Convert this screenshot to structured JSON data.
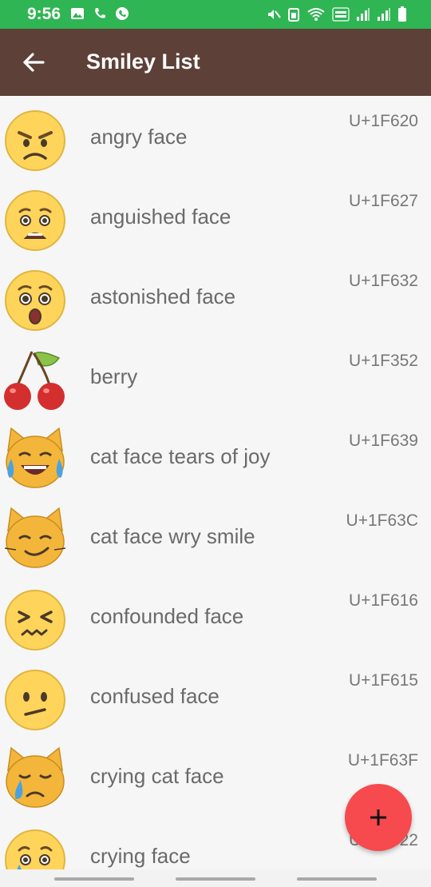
{
  "status_bar": {
    "time": "9:56",
    "bg_color": "#2fb553",
    "icons": [
      "gallery-icon",
      "call-icon",
      "whatsapp-icon",
      "mute-icon",
      "battery-saver-icon",
      "wifi-icon",
      "volte-icon",
      "signal-icon",
      "signal-icon",
      "battery-icon"
    ]
  },
  "toolbar": {
    "title": "Smiley List",
    "bg_color": "#5d4037",
    "back_icon": "arrow-left-icon"
  },
  "list": {
    "items": [
      {
        "name": "angry face",
        "code": "U+1F620",
        "icon": "angry-face-icon"
      },
      {
        "name": "anguished face",
        "code": "U+1F627",
        "icon": "anguished-face-icon"
      },
      {
        "name": "astonished face",
        "code": "U+1F632",
        "icon": "astonished-face-icon"
      },
      {
        "name": "berry",
        "code": "U+1F352",
        "icon": "cherries-icon"
      },
      {
        "name": "cat face tears of joy",
        "code": "U+1F639",
        "icon": "cat-joy-icon"
      },
      {
        "name": "cat face wry smile",
        "code": "U+1F63C",
        "icon": "cat-wry-smile-icon"
      },
      {
        "name": "confounded face",
        "code": "U+1F616",
        "icon": "confounded-face-icon"
      },
      {
        "name": "confused face",
        "code": "U+1F615",
        "icon": "confused-face-icon"
      },
      {
        "name": "crying cat face",
        "code": "U+1F63F",
        "icon": "crying-cat-icon"
      },
      {
        "name": "crying face",
        "code": "U+1F622",
        "icon": "crying-face-icon"
      }
    ]
  },
  "fab": {
    "label": "+",
    "color": "#f64a4f",
    "icon": "plus-icon"
  }
}
